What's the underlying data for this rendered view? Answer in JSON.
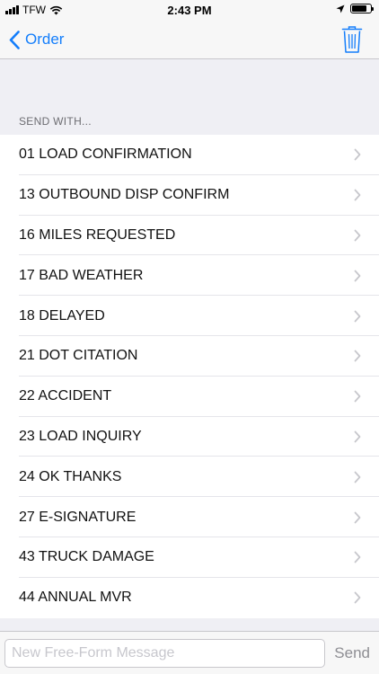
{
  "status_bar": {
    "carrier": "TFW",
    "time": "2:43 PM",
    "battery_level": 0.82
  },
  "nav": {
    "back_label": "Order",
    "back_icon": "chevron-left-icon",
    "trash_icon": "trash-icon"
  },
  "section": {
    "header": "SEND WITH..."
  },
  "items": [
    {
      "label": "01 LOAD CONFIRMATION"
    },
    {
      "label": "13 OUTBOUND DISP CONFIRM"
    },
    {
      "label": "16 MILES REQUESTED"
    },
    {
      "label": "17 BAD WEATHER"
    },
    {
      "label": "18 DELAYED"
    },
    {
      "label": "21 DOT CITATION"
    },
    {
      "label": "22 ACCIDENT"
    },
    {
      "label": "23 LOAD INQUIRY"
    },
    {
      "label": "24 OK THANKS"
    },
    {
      "label": "27 E-SIGNATURE"
    },
    {
      "label": "43 TRUCK DAMAGE"
    },
    {
      "label": "44 ANNUAL MVR"
    }
  ],
  "composer": {
    "placeholder": "New Free-Form Message",
    "value": "",
    "send_label": "Send"
  },
  "colors": {
    "accent": "#147efb",
    "background": "#efeff4",
    "disabled": "#8e8e93"
  }
}
